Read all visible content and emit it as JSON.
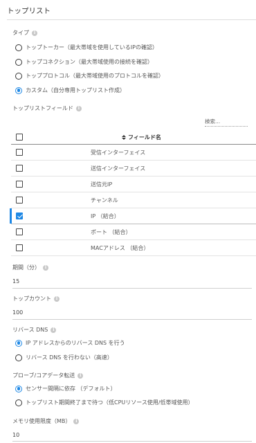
{
  "title": "トップリスト",
  "type_section": {
    "label": "タイプ",
    "options": [
      {
        "label": "トップトーカー（最大帯域を使用しているIPの確認）",
        "checked": false
      },
      {
        "label": "トップコネクション（最大帯域使用の接続を確認）",
        "checked": false
      },
      {
        "label": "トッププロトコル（最大帯域使用のプロトコルを確認）",
        "checked": false
      },
      {
        "label": "カスタム（自分専用トップリスト作成）",
        "checked": true
      }
    ]
  },
  "fields_section": {
    "label": "トップリストフィールド",
    "search_placeholder": "検索...",
    "column_header": "フィールド名",
    "rows": [
      {
        "name": "受信インターフェイス",
        "checked": false
      },
      {
        "name": "送信インターフェイス",
        "checked": false
      },
      {
        "name": "送信元IP",
        "checked": false
      },
      {
        "name": "チャンネル",
        "checked": false
      },
      {
        "name": "IP （結合）",
        "checked": true
      },
      {
        "name": "ポート （結合）",
        "checked": false
      },
      {
        "name": "MACアドレス （結合）",
        "checked": false
      }
    ]
  },
  "period": {
    "label": "期間（分）",
    "value": "15"
  },
  "top_count": {
    "label": "トップカウント",
    "value": "100"
  },
  "reverse_dns": {
    "label": "リバース DNS",
    "options": [
      {
        "label": "IP アドレスからのリバース DNS を行う",
        "checked": true
      },
      {
        "label": "リバース DNS を行わない（高速）",
        "checked": false
      }
    ]
  },
  "probe_transfer": {
    "label": "プローブ/コアデータ転送",
    "options": [
      {
        "label": "センサー間隔に依存 （デフォルト）",
        "checked": true
      },
      {
        "label": "トップリスト期間終了まで待つ（低CPUリソース使用/低帯域使用）",
        "checked": false
      }
    ]
  },
  "memory_limit": {
    "label": "メモリ使用限度（MB）",
    "value": "10"
  },
  "colors": {
    "accent": "#1e88e5",
    "text": "#444444",
    "divider": "#dcdcdc"
  },
  "icons": {
    "info": "info-icon",
    "sort": "sort-icon",
    "checkbox": "checkbox-icon",
    "radio": "radio-icon"
  }
}
